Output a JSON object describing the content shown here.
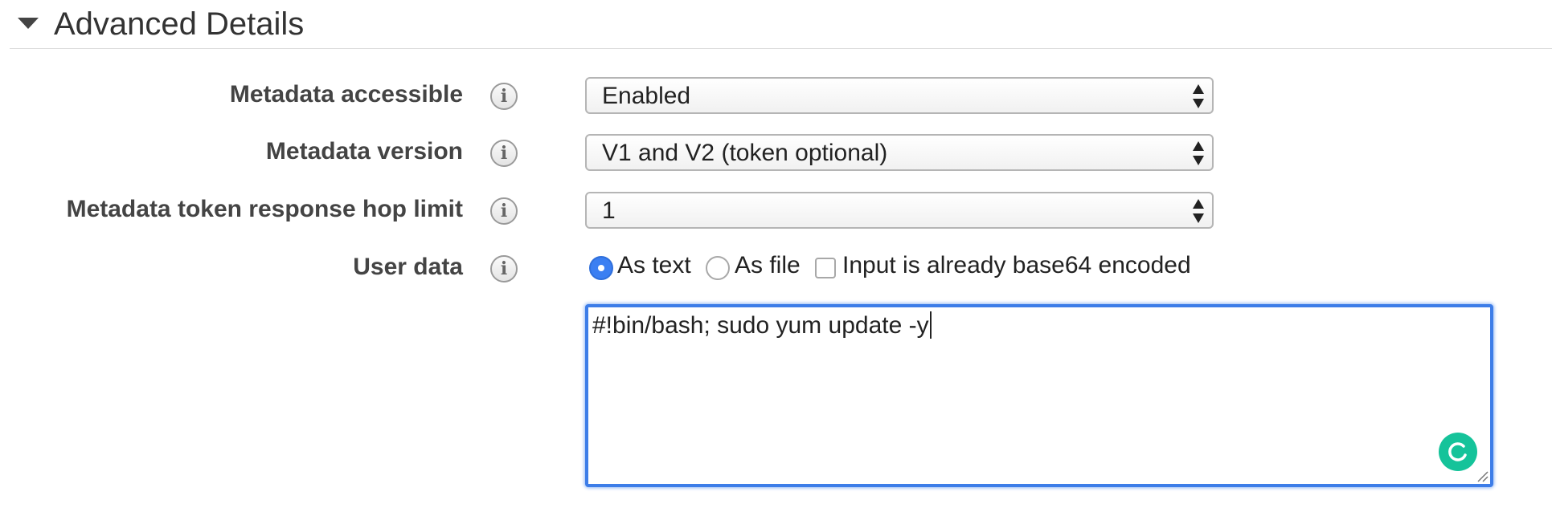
{
  "section": {
    "title": "Advanced Details",
    "expanded": true
  },
  "fields": {
    "metadata_accessible": {
      "label": "Metadata accessible",
      "value": "Enabled"
    },
    "metadata_version": {
      "label": "Metadata version",
      "value": "V1 and V2 (token optional)"
    },
    "hop_limit": {
      "label": "Metadata token response hop limit",
      "value": "1"
    },
    "user_data": {
      "label": "User data",
      "options": {
        "as_text": {
          "label": "As text",
          "checked": true
        },
        "as_file": {
          "label": "As file",
          "checked": false
        },
        "base64": {
          "label": "Input is already base64 encoded",
          "checked": false
        }
      },
      "text": "#!bin/bash; sudo yum update -y"
    }
  },
  "info_icon_glyph": "i",
  "icons": {
    "section_toggle": "caret-down-icon",
    "info": "info-icon",
    "select_arrows": "up-down-arrows-icon",
    "resize": "resize-handle-icon",
    "assistant": "grammarly-icon"
  },
  "colors": {
    "focus_blue": "#3d7de8",
    "radio_checked": "#3b7ff2",
    "assistant_green": "#15c39a"
  }
}
